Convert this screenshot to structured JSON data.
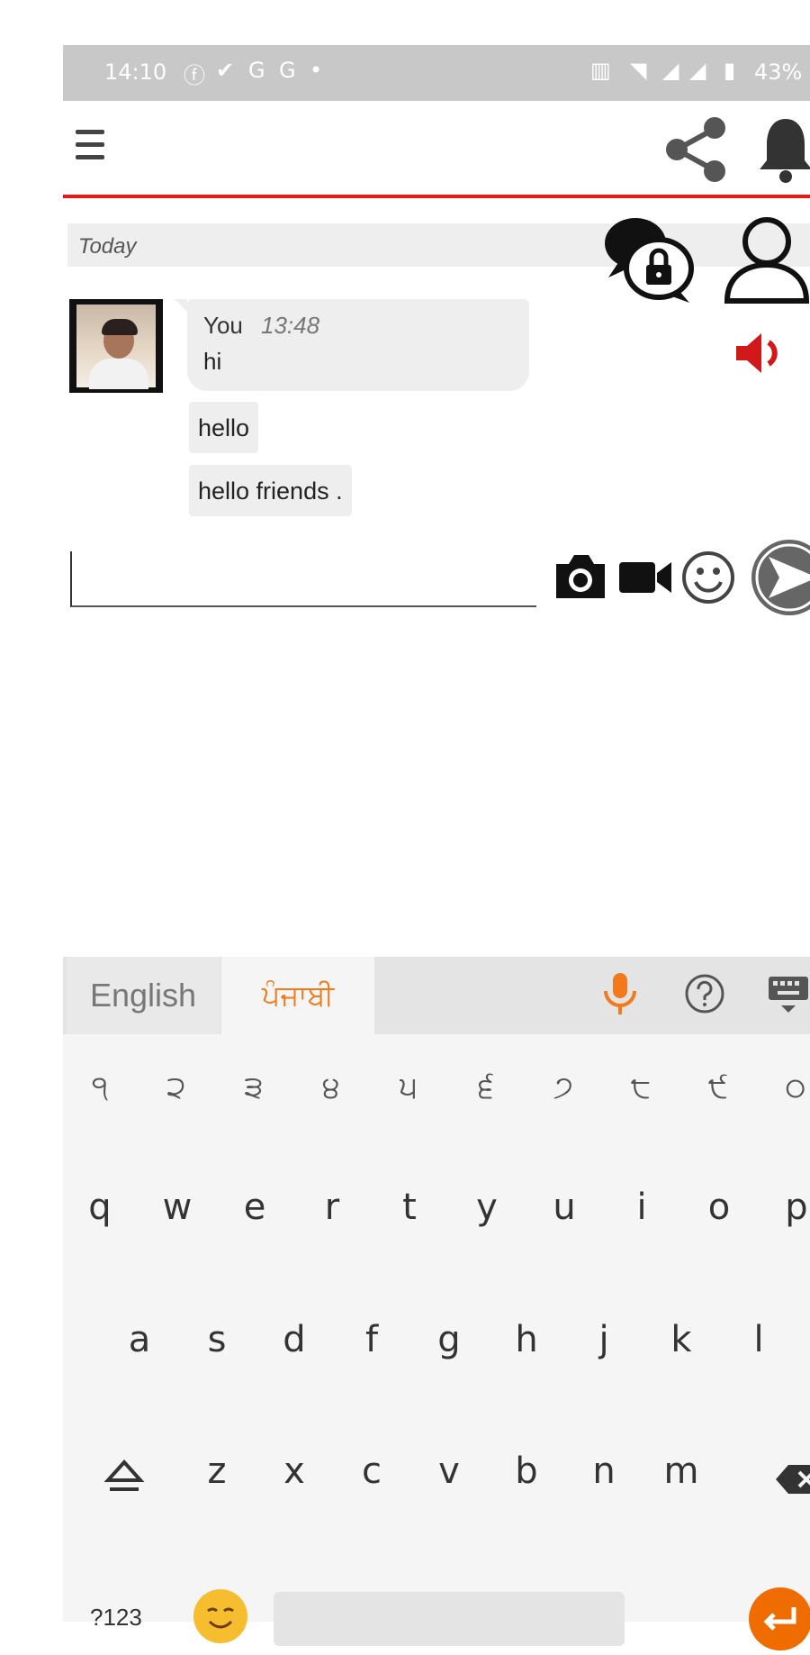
{
  "status_bar": {
    "time": "14:10",
    "notification_icons": [
      "facebook-icon",
      "check-circle-icon",
      "g-icon",
      "g-icon",
      "dot-icon"
    ],
    "system_icons": [
      "vibrate-icon",
      "wifi-icon",
      "signal-icon",
      "signal-icon",
      "battery-icon"
    ],
    "battery": "43%"
  },
  "header": {
    "icons": [
      "menu-icon",
      "share-icon",
      "bell-icon"
    ],
    "accent_color": "#e31b1b"
  },
  "chat": {
    "date_label": "Today",
    "sender": "You",
    "time": "13:48",
    "messages": [
      "hi",
      "hello",
      "hello friends ."
    ]
  },
  "composer": {
    "input_value": "",
    "icons": [
      "camera-icon",
      "video-icon",
      "emoji-icon",
      "send-icon"
    ]
  },
  "keyboard": {
    "languages": [
      "English",
      "ਪੰਜਾਬੀ"
    ],
    "active_language": "ਪੰਜਾਬੀ",
    "accent_color": "#f07a1c",
    "number_row": [
      "੧",
      "੨",
      "੩",
      "੪",
      "੫",
      "੬",
      "੭",
      "੮",
      "੯",
      "੦"
    ],
    "row1": [
      "q",
      "w",
      "e",
      "r",
      "t",
      "y",
      "u",
      "i",
      "o",
      "p"
    ],
    "row2": [
      "a",
      "s",
      "d",
      "f",
      "g",
      "h",
      "j",
      "k",
      "l"
    ],
    "row3": [
      "z",
      "x",
      "c",
      "v",
      "b",
      "n",
      "m"
    ],
    "symbols_label": "?123"
  }
}
